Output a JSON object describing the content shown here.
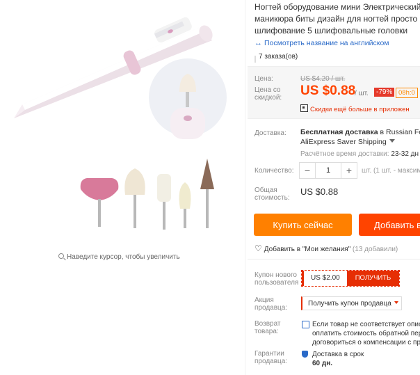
{
  "title_lines": [
    "Ногтей оборудование мини Электрический",
    "маникюра биты дизайн для ногтей просто",
    "шлифование 5 шлифовальные головки"
  ],
  "translate_link": "Посмотреть название на английском",
  "orders": "7 заказа(ов)",
  "gallery": {
    "zoom_hint": "Наведите курсор, чтобы увеличить"
  },
  "price": {
    "label": "Цена:",
    "old_price": "US $4.20 / шт.",
    "discount_label_1": "Цена со",
    "discount_label_2": "скидкой:",
    "new_price": "US $0.88",
    "unit": "/ шт.",
    "discount": "-79%",
    "timer": "08h:0",
    "app_promo": "Скидки ещё больше в приложен"
  },
  "shipping": {
    "label": "Доставка:",
    "free_text": "Бесплатная доставка",
    "destination": "в Russian Fed",
    "method": "AliExpress Saver Shipping",
    "eta_label": "Расчётное время доставки:",
    "eta_value": "23-32 дн"
  },
  "quantity": {
    "label": "Количество:",
    "value": "1",
    "minus": "−",
    "plus": "+",
    "note": "шт. (1 шт. - максим"
  },
  "total": {
    "label_1": "Общая",
    "label_2": "стоимость:",
    "value": "US $0.88"
  },
  "actions": {
    "buy_now": "Купить сейчас",
    "add_to_cart": "Добавить в"
  },
  "wishlist": {
    "text": "Добавить в \"Мои желания\"",
    "count": "(13 добавили)"
  },
  "coupon": {
    "label_1": "Купон нового",
    "label_2": "пользователя",
    "amount": "US $2.00",
    "get": "ПОЛУЧИТЬ"
  },
  "seller_promo": {
    "label_1": "Акция",
    "label_2": "продавца:",
    "button": "Получить купон продавца"
  },
  "returns": {
    "label_1": "Возврат",
    "label_2": "товара:",
    "lines": [
      "Если товар не соответствует опис",
      "оплатить стоимость обратной пер",
      "договориться о компенсации с пр"
    ]
  },
  "guarantee": {
    "label_1": "Гарантии",
    "label_2": "продавца:",
    "line_1": "Доставка в срок",
    "line_2": "60 дн."
  },
  "colors": {
    "accent_orange": "#ff8000",
    "accent_red": "#ff4400",
    "link_blue": "#2a6ac8"
  }
}
